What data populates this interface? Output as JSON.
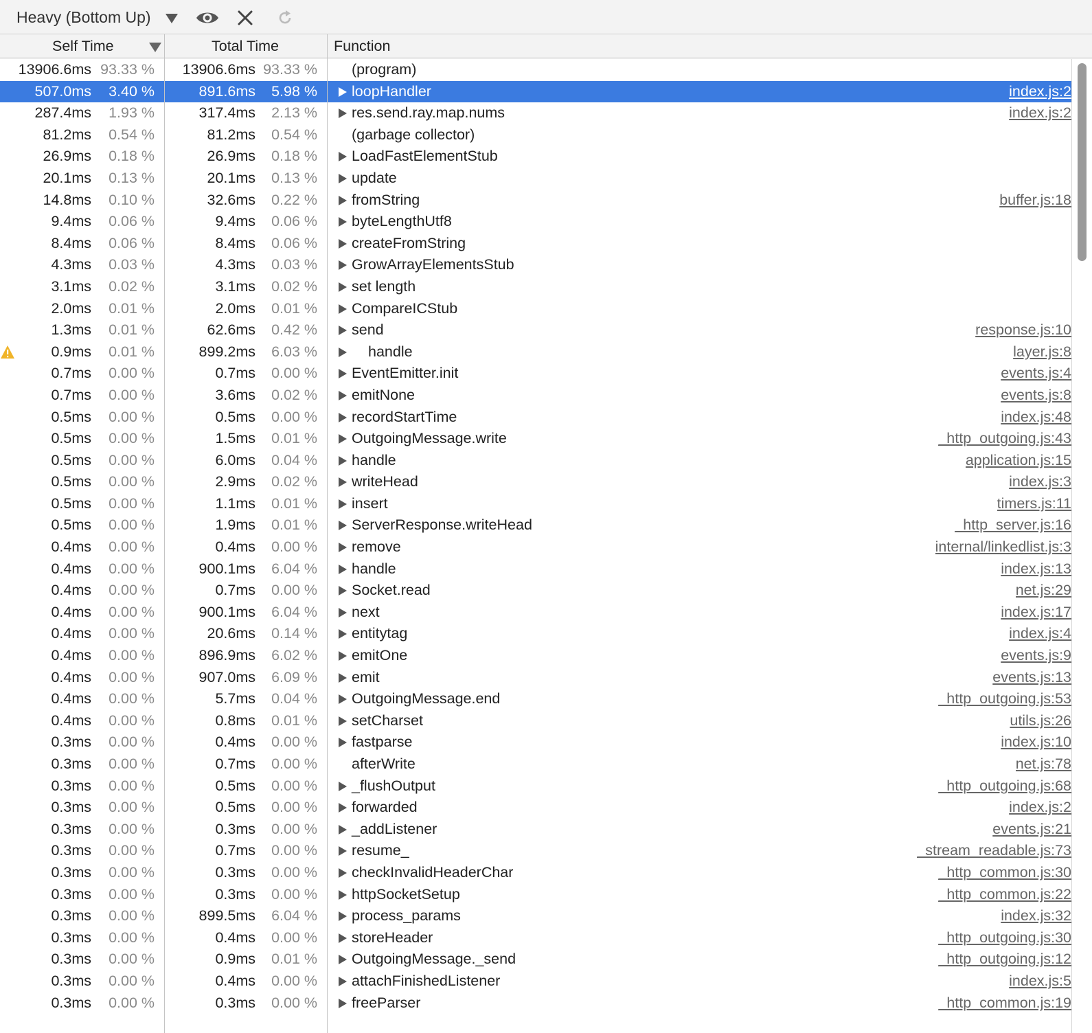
{
  "toolbar": {
    "view_label": "Heavy (Bottom Up)",
    "icons": [
      "chevron-down-icon",
      "eye-icon",
      "close-icon",
      "reload-icon"
    ]
  },
  "columns": {
    "self": "Self Time",
    "total": "Total Time",
    "function": "Function"
  },
  "colors": {
    "selection": "#3b7be0",
    "warning": "#f0b429"
  },
  "rows": [
    {
      "self": "13906.6ms",
      "self_pct": "93.33 %",
      "total": "13906.6ms",
      "total_pct": "93.33 %",
      "func": "(program)",
      "url": "",
      "arrow": false,
      "warn": false,
      "sel": false
    },
    {
      "self": "507.0ms",
      "self_pct": "3.40 %",
      "total": "891.6ms",
      "total_pct": "5.98 %",
      "func": "loopHandler",
      "url": "index.js:2",
      "arrow": true,
      "warn": false,
      "sel": true
    },
    {
      "self": "287.4ms",
      "self_pct": "1.93 %",
      "total": "317.4ms",
      "total_pct": "2.13 %",
      "func": "res.send.ray.map.nums",
      "url": "index.js:2",
      "arrow": true,
      "warn": false,
      "sel": false
    },
    {
      "self": "81.2ms",
      "self_pct": "0.54 %",
      "total": "81.2ms",
      "total_pct": "0.54 %",
      "func": "(garbage collector)",
      "url": "",
      "arrow": false,
      "warn": false,
      "sel": false
    },
    {
      "self": "26.9ms",
      "self_pct": "0.18 %",
      "total": "26.9ms",
      "total_pct": "0.18 %",
      "func": "LoadFastElementStub",
      "url": "",
      "arrow": true,
      "warn": false,
      "sel": false
    },
    {
      "self": "20.1ms",
      "self_pct": "0.13 %",
      "total": "20.1ms",
      "total_pct": "0.13 %",
      "func": "update",
      "url": "",
      "arrow": true,
      "warn": false,
      "sel": false
    },
    {
      "self": "14.8ms",
      "self_pct": "0.10 %",
      "total": "32.6ms",
      "total_pct": "0.22 %",
      "func": "fromString",
      "url": "buffer.js:18",
      "arrow": true,
      "warn": false,
      "sel": false
    },
    {
      "self": "9.4ms",
      "self_pct": "0.06 %",
      "total": "9.4ms",
      "total_pct": "0.06 %",
      "func": "byteLengthUtf8",
      "url": "",
      "arrow": true,
      "warn": false,
      "sel": false
    },
    {
      "self": "8.4ms",
      "self_pct": "0.06 %",
      "total": "8.4ms",
      "total_pct": "0.06 %",
      "func": "createFromString",
      "url": "",
      "arrow": true,
      "warn": false,
      "sel": false
    },
    {
      "self": "4.3ms",
      "self_pct": "0.03 %",
      "total": "4.3ms",
      "total_pct": "0.03 %",
      "func": "GrowArrayElementsStub",
      "url": "",
      "arrow": true,
      "warn": false,
      "sel": false
    },
    {
      "self": "3.1ms",
      "self_pct": "0.02 %",
      "total": "3.1ms",
      "total_pct": "0.02 %",
      "func": "set length",
      "url": "",
      "arrow": true,
      "warn": false,
      "sel": false
    },
    {
      "self": "2.0ms",
      "self_pct": "0.01 %",
      "total": "2.0ms",
      "total_pct": "0.01 %",
      "func": "CompareICStub",
      "url": "",
      "arrow": true,
      "warn": false,
      "sel": false
    },
    {
      "self": "1.3ms",
      "self_pct": "0.01 %",
      "total": "62.6ms",
      "total_pct": "0.42 %",
      "func": "send",
      "url": "response.js:10",
      "arrow": true,
      "warn": false,
      "sel": false
    },
    {
      "self": "0.9ms",
      "self_pct": "0.01 %",
      "total": "899.2ms",
      "total_pct": "6.03 %",
      "func": "handle",
      "url": "layer.js:8",
      "arrow": true,
      "warn": true,
      "sel": false
    },
    {
      "self": "0.7ms",
      "self_pct": "0.00 %",
      "total": "0.7ms",
      "total_pct": "0.00 %",
      "func": "EventEmitter.init",
      "url": "events.js:4",
      "arrow": true,
      "warn": false,
      "sel": false
    },
    {
      "self": "0.7ms",
      "self_pct": "0.00 %",
      "total": "3.6ms",
      "total_pct": "0.02 %",
      "func": "emitNone",
      "url": "events.js:8",
      "arrow": true,
      "warn": false,
      "sel": false
    },
    {
      "self": "0.5ms",
      "self_pct": "0.00 %",
      "total": "0.5ms",
      "total_pct": "0.00 %",
      "func": "recordStartTime",
      "url": "index.js:48",
      "arrow": true,
      "warn": false,
      "sel": false
    },
    {
      "self": "0.5ms",
      "self_pct": "0.00 %",
      "total": "1.5ms",
      "total_pct": "0.01 %",
      "func": "OutgoingMessage.write",
      "url": "_http_outgoing.js:43",
      "arrow": true,
      "warn": false,
      "sel": false
    },
    {
      "self": "0.5ms",
      "self_pct": "0.00 %",
      "total": "6.0ms",
      "total_pct": "0.04 %",
      "func": "handle",
      "url": "application.js:15",
      "arrow": true,
      "warn": false,
      "sel": false
    },
    {
      "self": "0.5ms",
      "self_pct": "0.00 %",
      "total": "2.9ms",
      "total_pct": "0.02 %",
      "func": "writeHead",
      "url": "index.js:3",
      "arrow": true,
      "warn": false,
      "sel": false
    },
    {
      "self": "0.5ms",
      "self_pct": "0.00 %",
      "total": "1.1ms",
      "total_pct": "0.01 %",
      "func": "insert",
      "url": "timers.js:11",
      "arrow": true,
      "warn": false,
      "sel": false
    },
    {
      "self": "0.5ms",
      "self_pct": "0.00 %",
      "total": "1.9ms",
      "total_pct": "0.01 %",
      "func": "ServerResponse.writeHead",
      "url": "_http_server.js:16",
      "arrow": true,
      "warn": false,
      "sel": false
    },
    {
      "self": "0.4ms",
      "self_pct": "0.00 %",
      "total": "0.4ms",
      "total_pct": "0.00 %",
      "func": "remove",
      "url": "internal/linkedlist.js:3",
      "arrow": true,
      "warn": false,
      "sel": false
    },
    {
      "self": "0.4ms",
      "self_pct": "0.00 %",
      "total": "900.1ms",
      "total_pct": "6.04 %",
      "func": "handle",
      "url": "index.js:13",
      "arrow": true,
      "warn": false,
      "sel": false
    },
    {
      "self": "0.4ms",
      "self_pct": "0.00 %",
      "total": "0.7ms",
      "total_pct": "0.00 %",
      "func": "Socket.read",
      "url": "net.js:29",
      "arrow": true,
      "warn": false,
      "sel": false
    },
    {
      "self": "0.4ms",
      "self_pct": "0.00 %",
      "total": "900.1ms",
      "total_pct": "6.04 %",
      "func": "next",
      "url": "index.js:17",
      "arrow": true,
      "warn": false,
      "sel": false
    },
    {
      "self": "0.4ms",
      "self_pct": "0.00 %",
      "total": "20.6ms",
      "total_pct": "0.14 %",
      "func": "entitytag",
      "url": "index.js:4",
      "arrow": true,
      "warn": false,
      "sel": false
    },
    {
      "self": "0.4ms",
      "self_pct": "0.00 %",
      "total": "896.9ms",
      "total_pct": "6.02 %",
      "func": "emitOne",
      "url": "events.js:9",
      "arrow": true,
      "warn": false,
      "sel": false
    },
    {
      "self": "0.4ms",
      "self_pct": "0.00 %",
      "total": "907.0ms",
      "total_pct": "6.09 %",
      "func": "emit",
      "url": "events.js:13",
      "arrow": true,
      "warn": false,
      "sel": false
    },
    {
      "self": "0.4ms",
      "self_pct": "0.00 %",
      "total": "5.7ms",
      "total_pct": "0.04 %",
      "func": "OutgoingMessage.end",
      "url": "_http_outgoing.js:53",
      "arrow": true,
      "warn": false,
      "sel": false
    },
    {
      "self": "0.4ms",
      "self_pct": "0.00 %",
      "total": "0.8ms",
      "total_pct": "0.01 %",
      "func": "setCharset",
      "url": "utils.js:26",
      "arrow": true,
      "warn": false,
      "sel": false
    },
    {
      "self": "0.3ms",
      "self_pct": "0.00 %",
      "total": "0.4ms",
      "total_pct": "0.00 %",
      "func": "fastparse",
      "url": "index.js:10",
      "arrow": true,
      "warn": false,
      "sel": false
    },
    {
      "self": "0.3ms",
      "self_pct": "0.00 %",
      "total": "0.7ms",
      "total_pct": "0.00 %",
      "func": "afterWrite",
      "url": "net.js:78",
      "arrow": false,
      "warn": false,
      "sel": false
    },
    {
      "self": "0.3ms",
      "self_pct": "0.00 %",
      "total": "0.5ms",
      "total_pct": "0.00 %",
      "func": "_flushOutput",
      "url": "_http_outgoing.js:68",
      "arrow": true,
      "warn": false,
      "sel": false
    },
    {
      "self": "0.3ms",
      "self_pct": "0.00 %",
      "total": "0.5ms",
      "total_pct": "0.00 %",
      "func": "forwarded",
      "url": "index.js:2",
      "arrow": true,
      "warn": false,
      "sel": false
    },
    {
      "self": "0.3ms",
      "self_pct": "0.00 %",
      "total": "0.3ms",
      "total_pct": "0.00 %",
      "func": "_addListener",
      "url": "events.js:21",
      "arrow": true,
      "warn": false,
      "sel": false
    },
    {
      "self": "0.3ms",
      "self_pct": "0.00 %",
      "total": "0.7ms",
      "total_pct": "0.00 %",
      "func": "resume_",
      "url": "_stream_readable.js:73",
      "arrow": true,
      "warn": false,
      "sel": false
    },
    {
      "self": "0.3ms",
      "self_pct": "0.00 %",
      "total": "0.3ms",
      "total_pct": "0.00 %",
      "func": "checkInvalidHeaderChar",
      "url": "_http_common.js:30",
      "arrow": true,
      "warn": false,
      "sel": false
    },
    {
      "self": "0.3ms",
      "self_pct": "0.00 %",
      "total": "0.3ms",
      "total_pct": "0.00 %",
      "func": "httpSocketSetup",
      "url": "_http_common.js:22",
      "arrow": true,
      "warn": false,
      "sel": false
    },
    {
      "self": "0.3ms",
      "self_pct": "0.00 %",
      "total": "899.5ms",
      "total_pct": "6.04 %",
      "func": "process_params",
      "url": "index.js:32",
      "arrow": true,
      "warn": false,
      "sel": false
    },
    {
      "self": "0.3ms",
      "self_pct": "0.00 %",
      "total": "0.4ms",
      "total_pct": "0.00 %",
      "func": "storeHeader",
      "url": "_http_outgoing.js:30",
      "arrow": true,
      "warn": false,
      "sel": false
    },
    {
      "self": "0.3ms",
      "self_pct": "0.00 %",
      "total": "0.9ms",
      "total_pct": "0.01 %",
      "func": "OutgoingMessage._send",
      "url": "_http_outgoing.js:12",
      "arrow": true,
      "warn": false,
      "sel": false
    },
    {
      "self": "0.3ms",
      "self_pct": "0.00 %",
      "total": "0.4ms",
      "total_pct": "0.00 %",
      "func": "attachFinishedListener",
      "url": "index.js:5",
      "arrow": true,
      "warn": false,
      "sel": false
    },
    {
      "self": "0.3ms",
      "self_pct": "0.00 %",
      "total": "0.3ms",
      "total_pct": "0.00 %",
      "func": "freeParser",
      "url": "_http_common.js:19",
      "arrow": true,
      "warn": false,
      "sel": false
    }
  ]
}
